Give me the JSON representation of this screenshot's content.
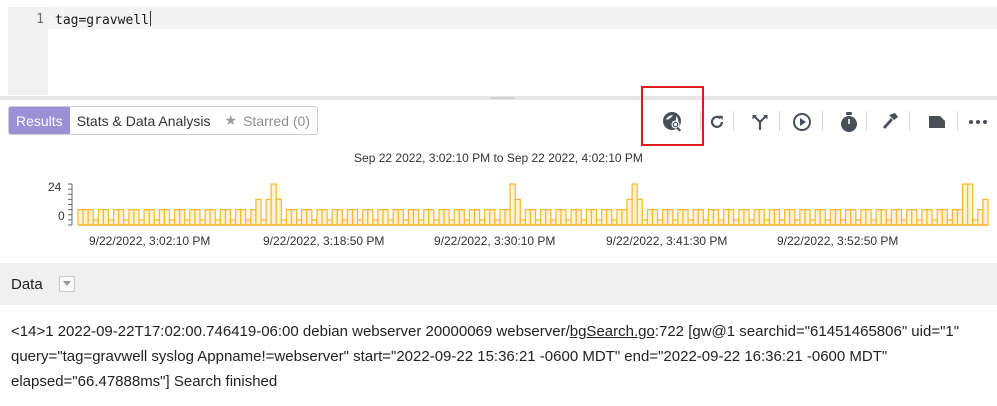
{
  "editor": {
    "line_number": "1",
    "query": "tag=gravwell"
  },
  "tabs": [
    {
      "label": "Results",
      "active": true
    },
    {
      "label": "Stats & Data Analysis",
      "active": false
    },
    {
      "label": "Starred (0)",
      "active": false
    }
  ],
  "toolbar": {
    "icons": [
      "search-overview-icon",
      "refresh-icon",
      "fork-icon",
      "play-icon",
      "timer-icon",
      "hammer-icon",
      "label-icon",
      "more-icon"
    ]
  },
  "timeframe": "Sep 22 2022, 3:02:10 PM to Sep 22 2022, 4:02:10 PM",
  "chart_data": {
    "type": "bar",
    "y_ticks": [
      "24",
      "0"
    ],
    "x_tick_labels": [
      "9/22/2022, 3:02:10 PM",
      "9/22/2022, 3:18:50 PM",
      "9/22/2022, 3:30:10 PM",
      "9/22/2022, 3:41:30 PM",
      "9/22/2022, 3:52:50 PM"
    ],
    "ylim": [
      0,
      24
    ],
    "color": "#f5b731",
    "values": [
      9,
      9,
      9,
      3,
      9,
      9,
      3,
      9,
      9,
      3,
      9,
      9,
      3,
      9,
      9,
      3,
      9,
      9,
      3,
      9,
      9,
      3,
      9,
      9,
      3,
      9,
      9,
      3,
      9,
      9,
      3,
      9,
      9,
      3,
      9,
      15,
      3,
      15,
      24,
      15,
      3,
      9,
      9,
      3,
      9,
      9,
      3,
      9,
      9,
      3,
      9,
      9,
      3,
      9,
      9,
      3,
      9,
      9,
      3,
      9,
      9,
      3,
      9,
      9,
      3,
      9,
      9,
      3,
      9,
      9,
      3,
      9,
      9,
      3,
      9,
      9,
      3,
      9,
      9,
      3,
      9,
      9,
      3,
      9,
      9,
      24,
      15,
      3,
      9,
      9,
      3,
      9,
      9,
      3,
      9,
      9,
      3,
      9,
      9,
      3,
      9,
      9,
      3,
      9,
      9,
      3,
      9,
      9,
      15,
      24,
      15,
      3,
      9,
      9,
      3,
      9,
      9,
      3,
      9,
      9,
      3,
      9,
      9,
      3,
      9,
      9,
      3,
      9,
      9,
      3,
      9,
      9,
      3,
      9,
      9,
      3,
      9,
      9,
      3,
      9,
      9,
      3,
      9,
      9,
      3,
      9,
      9,
      3,
      9,
      9,
      3,
      9,
      9,
      3,
      9,
      9,
      3,
      9,
      9,
      3,
      9,
      9,
      3,
      9,
      9,
      3,
      9,
      9,
      3,
      9,
      9,
      3,
      9,
      9,
      24,
      24,
      3,
      9,
      15
    ]
  },
  "data_section": {
    "label": "Data",
    "log_part1": "<14>1 2022-09-22T17:02:00.746419-06:00 debian webserver 20000069 webserver/",
    "log_link": "bgSearch.go",
    "log_part2": ":722 [gw@1 searchid=\"61451465806\" uid=\"1\" query=\"tag=gravwell syslog Appname!=webserver\" start=\"2022-09-22 15:36:21 -0600 MDT\" end=\"2022-09-22 16:36:21 -0600 MDT\" elapsed=\"66.47888ms\"] Search finished"
  }
}
